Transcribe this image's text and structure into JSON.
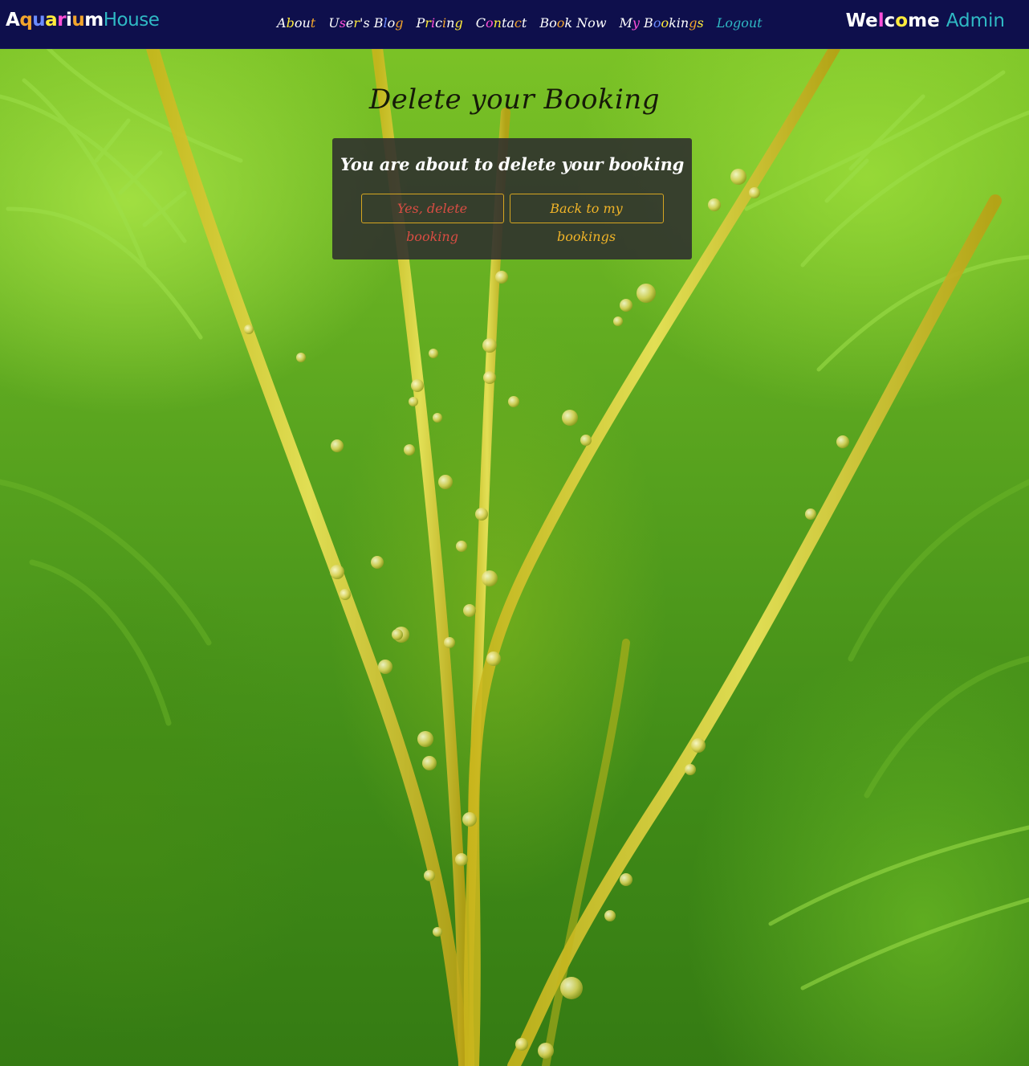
{
  "brand": {
    "part_a": "Aquarium",
    "part_b": "House",
    "letter_colors": [
      "#ffffff",
      "#f2a52c",
      "#6b8cff",
      "#ffeb3b",
      "#ff4fd8",
      "#ffffff",
      "#f2a52c",
      "#ffffff"
    ]
  },
  "nav": {
    "items": [
      {
        "label": "About",
        "colors": [
          "#ffffff",
          "#ffeb3b",
          "#ffffff",
          "#ffffff",
          "#f2a52c"
        ]
      },
      {
        "label": "User's Blog",
        "colors": [
          "#ffffff",
          "#ff4fd8",
          "#ffffff",
          "#ffeb3b",
          "#ffffff",
          "#ffffff",
          "#ffffff",
          "#6b8cff",
          "#ffffff",
          "#f2a52c",
          "#ffffff"
        ]
      },
      {
        "label": "Pricing",
        "colors": [
          "#ffffff",
          "#ffeb3b",
          "#ff4fd8",
          "#ffffff",
          "#f2a52c",
          "#ffffff",
          "#ffeb3b"
        ]
      },
      {
        "label": "Contact",
        "colors": [
          "#ffffff",
          "#ff4fd8",
          "#ffeb3b",
          "#ffffff",
          "#ffffff",
          "#f2a52c",
          "#ffffff"
        ]
      },
      {
        "label": "Book Now",
        "colors": [
          "#ffffff",
          "#ffffff",
          "#f2a52c",
          "#ffffff",
          "#ffffff",
          "#ffffff",
          "#ffffff",
          "#ffffff"
        ]
      },
      {
        "label": "My Bookings",
        "colors": [
          "#ffffff",
          "#ff4fd8",
          "#ffffff",
          "#6b8cff",
          "#ffeb3b",
          "#ffffff",
          "#ffffff",
          "#ffffff",
          "#f2a52c",
          "#ffeb3b",
          "#ff4fd8"
        ]
      },
      {
        "label": "Logout",
        "colors": [
          "#2fb9c4",
          "#2fb9c4",
          "#2fb9c4",
          "#2fb9c4",
          "#2fb9c4",
          "#2fb9c4"
        ]
      }
    ]
  },
  "welcome": {
    "greeting": "Welcome",
    "user": "Admin",
    "greeting_colors": [
      "#ffffff",
      "#ffffff",
      "#ff4fd8",
      "#ffffff",
      "#ffeb3b",
      "#ffffff",
      "#ffffff"
    ]
  },
  "main": {
    "title": "Delete your Booking",
    "card_heading": "You are about to delete your booking",
    "delete_button": "Yes, delete booking",
    "back_button": "Back to my bookings"
  },
  "colors": {
    "navbar_bg": "#0e0f4c",
    "accent_teal": "#2fb9c4",
    "button_border": "#d5a521",
    "delete_text": "#d94d43",
    "back_text": "#f0b428"
  }
}
